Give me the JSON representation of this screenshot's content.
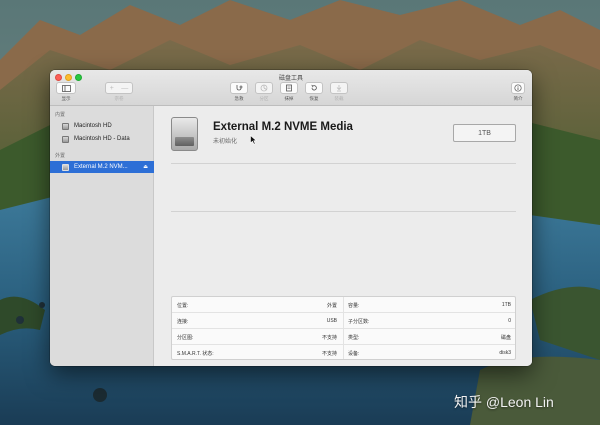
{
  "window": {
    "title": "磁盘工具"
  },
  "toolbar": {
    "view_label": "显示",
    "volume_label": "宗卷",
    "first_aid_label": "急救",
    "partition_label": "分区",
    "erase_label": "抹掉",
    "restore_label": "恢复",
    "mount_label": "装载",
    "info_label": "简介",
    "add_symbol": "+",
    "remove_symbol": "—",
    "view_icon": "sidebar-view-icon",
    "first_aid_icon": "stethoscope-icon",
    "partition_icon": "partition-icon",
    "erase_icon": "erase-icon",
    "restore_icon": "restore-icon",
    "mount_icon": "mount-icon",
    "info_icon": "info-icon"
  },
  "sidebar": {
    "internal_header": "内置",
    "external_header": "外置",
    "internal_items": [
      {
        "label": "Macintosh HD"
      },
      {
        "label": "Macintosh HD - Data"
      }
    ],
    "external_items": [
      {
        "label": "External M.2 NVM...",
        "selected": true,
        "eject_symbol": "⏏"
      }
    ]
  },
  "disk": {
    "name": "External M.2 NVME Media",
    "status": "未初始化",
    "size": "1TB"
  },
  "info": {
    "rows": [
      {
        "k1": "位置:",
        "v1": "外置",
        "k2": "容量:",
        "v2": "1TB"
      },
      {
        "k1": "连接:",
        "v1": "USB",
        "k2": "子分区数:",
        "v2": "0"
      },
      {
        "k1": "分区图:",
        "v1": "不支持",
        "k2": "类型:",
        "v2": "磁盘"
      },
      {
        "k1": "S.M.A.R.T. 状态:",
        "v1": "不支持",
        "k2": "设备:",
        "v2": "disk3"
      }
    ]
  },
  "watermark": "知乎 @Leon Lin",
  "colors": {
    "selection": "#2d6fd6",
    "close": "#fc5f57",
    "minimize": "#fdbc2e",
    "maximize": "#28c840"
  }
}
